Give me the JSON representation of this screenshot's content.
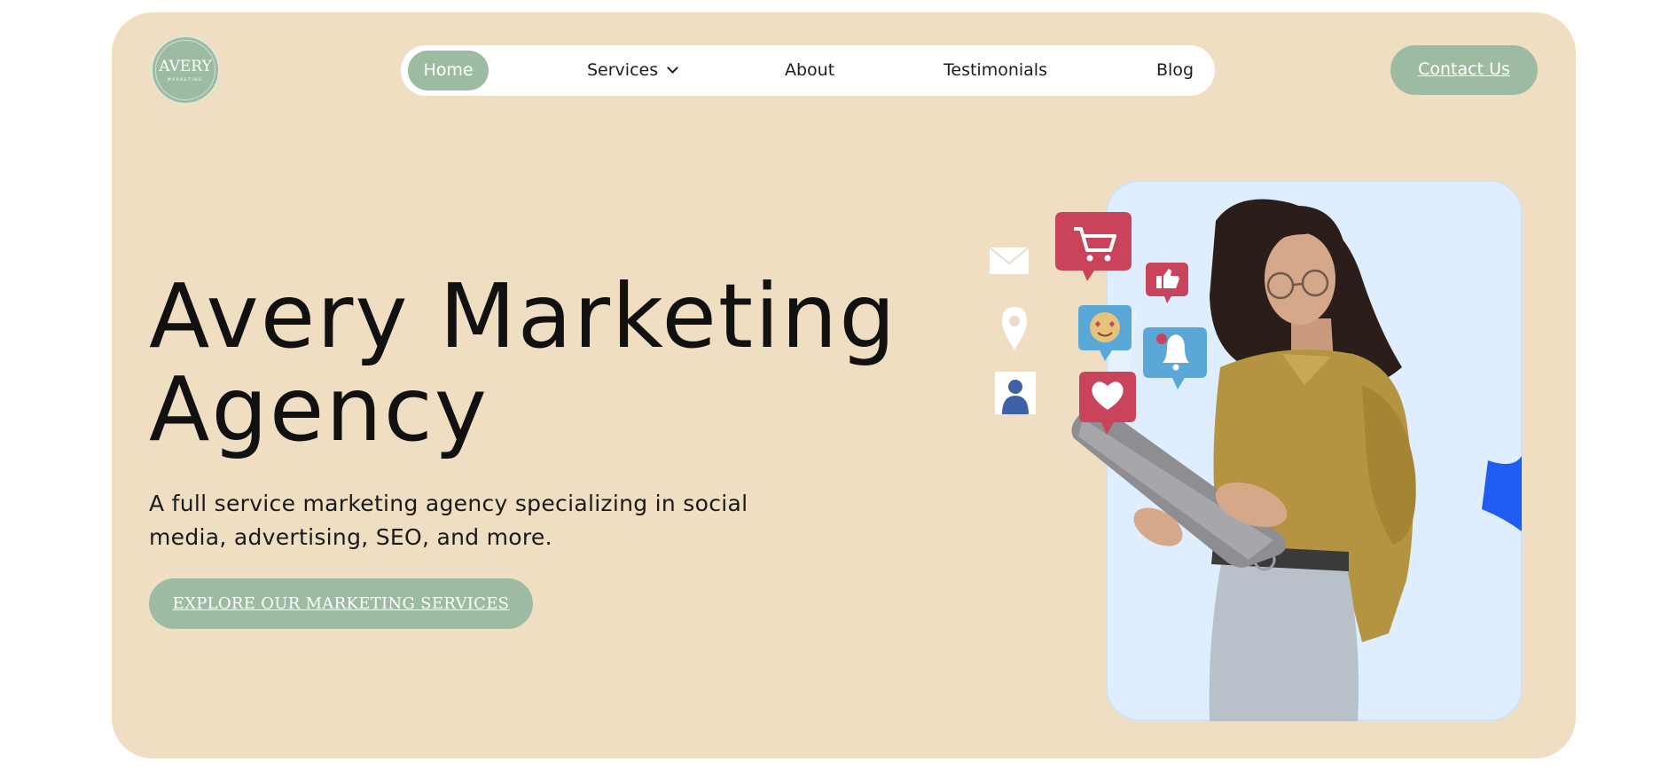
{
  "brand": {
    "logo_text": "AVERY",
    "logo_subtext": "MARKETING"
  },
  "nav": {
    "items": [
      {
        "label": "Home",
        "active": true
      },
      {
        "label": "Services",
        "has_dropdown": true
      },
      {
        "label": "About"
      },
      {
        "label": "Testimonials"
      },
      {
        "label": "Blog"
      }
    ]
  },
  "header": {
    "contact_label": "Contact Us"
  },
  "hero": {
    "title_line1": "Avery Marketing",
    "title_line2": "Agency",
    "subtitle": "A full service marketing agency specializing in social media, advertising, SEO, and more.",
    "cta_label": "EXPLORE OUR MARKETING SERVICES"
  },
  "illustration": {
    "icons": [
      "mail-icon",
      "location-pin-icon",
      "user-contact-icon",
      "shopping-cart-icon",
      "thumbs-up-icon",
      "heart-eyes-emoji-icon",
      "heart-icon",
      "notification-bell-icon"
    ],
    "person": "woman holding tablet"
  },
  "colors": {
    "page_bg": "#ffffff",
    "card_bg": "#f0dec2",
    "accent_green": "#9dbba2",
    "photo_bg": "#deeefe",
    "bubble_red": "#c9435a",
    "bubble_blue": "#5aa8d8",
    "accent_blue": "#1f5cf2"
  }
}
